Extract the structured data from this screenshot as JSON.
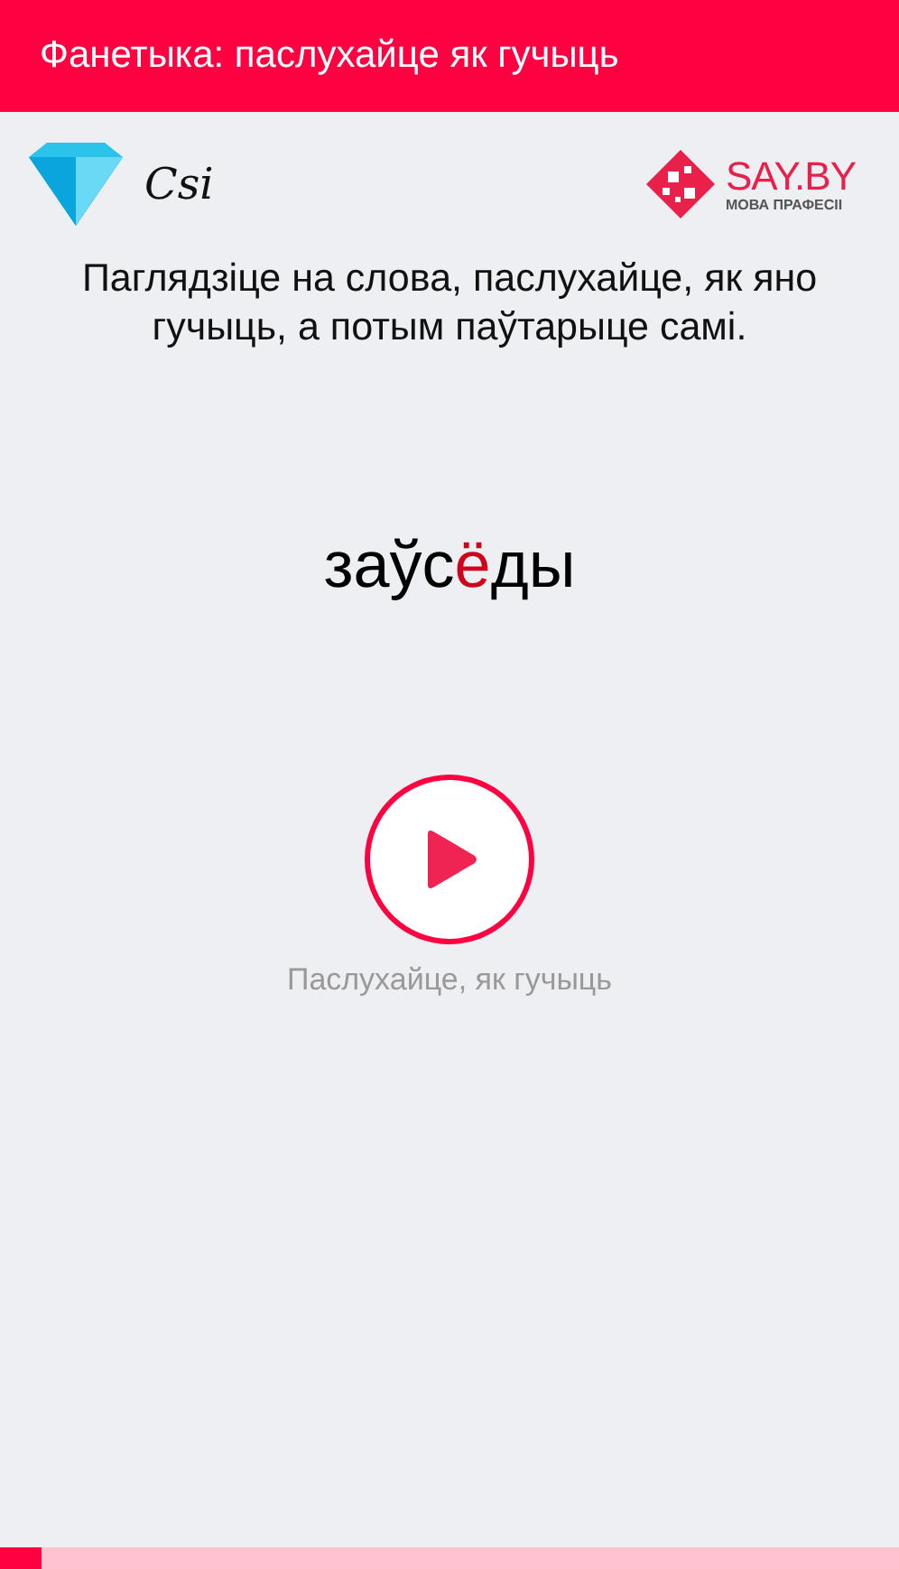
{
  "header": {
    "title": "Фанетыка: паслухайце як гучыць"
  },
  "logos": {
    "left": "Csi",
    "right_title": "SAY.BY",
    "right_subtitle": "МОВА ПРАФЕСІІ"
  },
  "instruction": "Паглядзіце на слова, паслухайце, як яно гучыць, а потым паўтарыце самі.",
  "word": [
    {
      "text": "заўс",
      "stressed": false
    },
    {
      "text": "ё",
      "stressed": true
    },
    {
      "text": "ды",
      "stressed": false
    }
  ],
  "play": {
    "caption": "Паслухайце, як гучыць"
  },
  "progress": {
    "level": 0.046
  }
}
